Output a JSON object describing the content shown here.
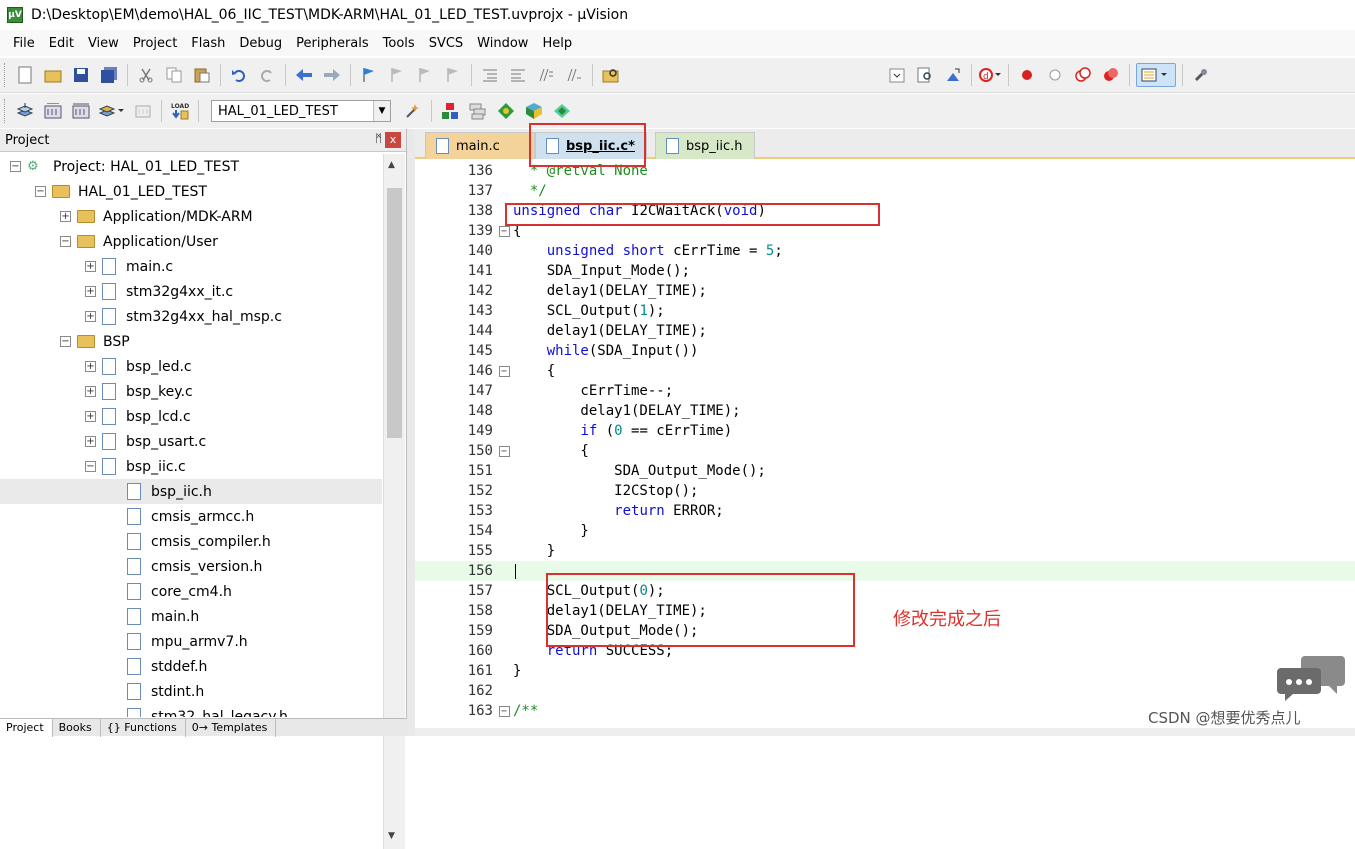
{
  "window": {
    "title": "D:\\Desktop\\EM\\demo\\HAL_06_IIC_TEST\\MDK-ARM\\HAL_01_LED_TEST.uvprojx - µVision",
    "app_icon": "µV"
  },
  "menu": [
    "File",
    "Edit",
    "View",
    "Project",
    "Flash",
    "Debug",
    "Peripherals",
    "Tools",
    "SVCS",
    "Window",
    "Help"
  ],
  "toolbar": {
    "target": "HAL_01_LED_TEST"
  },
  "project_panel": {
    "title": "Project",
    "pin": "ᛗ",
    "close": "x",
    "tree": [
      {
        "label": "Project: HAL_01_LED_TEST",
        "exp": "⊟",
        "type": "project"
      },
      {
        "label": "HAL_01_LED_TEST",
        "exp": "⊟",
        "type": "folder"
      },
      {
        "label": "Application/MDK-ARM",
        "exp": "⊞",
        "type": "folder"
      },
      {
        "label": "Application/User",
        "exp": "⊟",
        "type": "folder"
      },
      {
        "label": "main.c",
        "exp": "⊞",
        "type": "file"
      },
      {
        "label": "stm32g4xx_it.c",
        "exp": "⊞",
        "type": "file"
      },
      {
        "label": "stm32g4xx_hal_msp.c",
        "exp": "⊞",
        "type": "file"
      },
      {
        "label": "BSP",
        "exp": "⊟",
        "type": "folder"
      },
      {
        "label": "bsp_led.c",
        "exp": "⊞",
        "type": "file"
      },
      {
        "label": "bsp_key.c",
        "exp": "⊞",
        "type": "file"
      },
      {
        "label": "bsp_lcd.c",
        "exp": "⊞",
        "type": "file"
      },
      {
        "label": "bsp_usart.c",
        "exp": "⊞",
        "type": "file"
      },
      {
        "label": "bsp_iic.c",
        "exp": "⊟",
        "type": "file"
      },
      {
        "label": "bsp_iic.h",
        "exp": "",
        "type": "file"
      },
      {
        "label": "cmsis_armcc.h",
        "exp": "",
        "type": "file"
      },
      {
        "label": "cmsis_compiler.h",
        "exp": "",
        "type": "file"
      },
      {
        "label": "cmsis_version.h",
        "exp": "",
        "type": "file"
      },
      {
        "label": "core_cm4.h",
        "exp": "",
        "type": "file"
      },
      {
        "label": "main.h",
        "exp": "",
        "type": "file"
      },
      {
        "label": "mpu_armv7.h",
        "exp": "",
        "type": "file"
      },
      {
        "label": "stddef.h",
        "exp": "",
        "type": "file"
      },
      {
        "label": "stdint.h",
        "exp": "",
        "type": "file"
      },
      {
        "label": "stm32_hal_legacy.h",
        "exp": "",
        "type": "file"
      }
    ],
    "bottom_tabs": [
      "Project",
      "Books",
      "{} Functions",
      "0→ Templates"
    ]
  },
  "editor": {
    "tabs": [
      "main.c",
      "bsp_iic.c*",
      "bsp_iic.h"
    ],
    "lines": [
      {
        "n": "136",
        "fold": "",
        "segs": [
          {
            "t": "  * @retval None",
            "c": "cm"
          }
        ]
      },
      {
        "n": "137",
        "fold": "",
        "segs": [
          {
            "t": "  */",
            "c": "cm"
          }
        ]
      },
      {
        "n": "138",
        "fold": "",
        "segs": [
          {
            "t": "unsigned",
            "c": "kw"
          },
          {
            "t": " "
          },
          {
            "t": "char",
            "c": "kw"
          },
          {
            "t": " I2CWaitAck("
          },
          {
            "t": "void",
            "c": "kw"
          },
          {
            "t": ")"
          }
        ]
      },
      {
        "n": "139",
        "fold": "⊟",
        "segs": [
          {
            "t": "{"
          }
        ]
      },
      {
        "n": "140",
        "fold": "",
        "segs": [
          {
            "t": "    "
          },
          {
            "t": "unsigned",
            "c": "kw"
          },
          {
            "t": " "
          },
          {
            "t": "short",
            "c": "kw"
          },
          {
            "t": " cErrTime = "
          },
          {
            "t": "5",
            "c": "num"
          },
          {
            "t": ";"
          }
        ]
      },
      {
        "n": "141",
        "fold": "",
        "segs": [
          {
            "t": "    SDA_Input_Mode();"
          }
        ]
      },
      {
        "n": "142",
        "fold": "",
        "segs": [
          {
            "t": "    delay1(DELAY_TIME);"
          }
        ]
      },
      {
        "n": "143",
        "fold": "",
        "segs": [
          {
            "t": "    SCL_Output("
          },
          {
            "t": "1",
            "c": "num"
          },
          {
            "t": ");"
          }
        ]
      },
      {
        "n": "144",
        "fold": "",
        "segs": [
          {
            "t": "    delay1(DELAY_TIME);"
          }
        ]
      },
      {
        "n": "145",
        "fold": "",
        "segs": [
          {
            "t": "    "
          },
          {
            "t": "while",
            "c": "kw"
          },
          {
            "t": "(SDA_Input())"
          }
        ]
      },
      {
        "n": "146",
        "fold": "⊟",
        "segs": [
          {
            "t": "    {"
          }
        ]
      },
      {
        "n": "147",
        "fold": "",
        "segs": [
          {
            "t": "        cErrTime--;"
          }
        ]
      },
      {
        "n": "148",
        "fold": "",
        "segs": [
          {
            "t": "        delay1(DELAY_TIME);"
          }
        ]
      },
      {
        "n": "149",
        "fold": "",
        "segs": [
          {
            "t": "        "
          },
          {
            "t": "if",
            "c": "kw"
          },
          {
            "t": " ("
          },
          {
            "t": "0",
            "c": "num"
          },
          {
            "t": " == cErrTime)"
          }
        ]
      },
      {
        "n": "150",
        "fold": "⊟",
        "segs": [
          {
            "t": "        {"
          }
        ]
      },
      {
        "n": "151",
        "fold": "",
        "segs": [
          {
            "t": "            SDA_Output_Mode();"
          }
        ]
      },
      {
        "n": "152",
        "fold": "",
        "segs": [
          {
            "t": "            I2CStop();"
          }
        ]
      },
      {
        "n": "153",
        "fold": "",
        "segs": [
          {
            "t": "            "
          },
          {
            "t": "return",
            "c": "kw"
          },
          {
            "t": " ERROR;"
          }
        ]
      },
      {
        "n": "154",
        "fold": "",
        "segs": [
          {
            "t": "        }"
          }
        ]
      },
      {
        "n": "155",
        "fold": "",
        "segs": [
          {
            "t": "    }"
          }
        ]
      },
      {
        "n": "156",
        "fold": "",
        "segs": [
          {
            "t": ""
          }
        ],
        "hl": true
      },
      {
        "n": "157",
        "fold": "",
        "segs": [
          {
            "t": "    SCL_Output("
          },
          {
            "t": "0",
            "c": "num"
          },
          {
            "t": ");"
          }
        ]
      },
      {
        "n": "158",
        "fold": "",
        "segs": [
          {
            "t": "    delay1(DELAY_TIME);"
          }
        ]
      },
      {
        "n": "159",
        "fold": "",
        "segs": [
          {
            "t": "    SDA_Output_Mode();"
          }
        ]
      },
      {
        "n": "160",
        "fold": "",
        "segs": [
          {
            "t": "    "
          },
          {
            "t": "return",
            "c": "kw"
          },
          {
            "t": " SUCCESS;"
          }
        ]
      },
      {
        "n": "161",
        "fold": "",
        "segs": [
          {
            "t": "}"
          }
        ]
      },
      {
        "n": "162",
        "fold": "",
        "segs": [
          {
            "t": ""
          }
        ]
      },
      {
        "n": "163",
        "fold": "⊟",
        "segs": [
          {
            "t": "/**",
            "c": "cm"
          }
        ]
      }
    ]
  },
  "annotation": "修改完成之后",
  "watermark": "CSDN @想要优秀点儿",
  "colors": {
    "keyword": "#1010d0",
    "number": "#008c8c",
    "comment": "#1c8c1c",
    "annotation": "#e0302c"
  }
}
